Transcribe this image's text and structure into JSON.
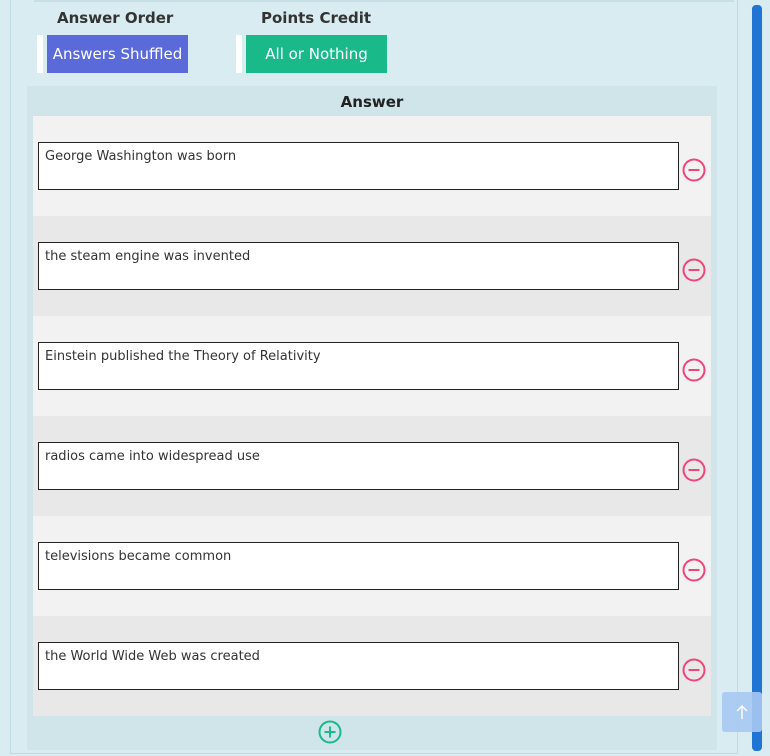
{
  "options": {
    "answer_order": {
      "title": "Answer Order",
      "button_label": "Answers Shuffled",
      "color": "#5a6ad8"
    },
    "points_credit": {
      "title": "Points Credit",
      "button_label": "All or Nothing",
      "color": "#1ab989"
    }
  },
  "answers": {
    "header": "Answer",
    "items": [
      {
        "value": "George Washington was born"
      },
      {
        "value": "the steam engine was invented"
      },
      {
        "value": "Einstein published the Theory of Relativity"
      },
      {
        "value": "radios came into widespread use"
      },
      {
        "value": "televisions became common"
      },
      {
        "value": "the World Wide Web was created"
      }
    ],
    "remove_icon": "minus-circle-icon",
    "add_icon": "plus-circle-icon",
    "remove_color": "#f0457a",
    "add_color": "#1ab989"
  },
  "scroll_top_icon": "arrow-up-icon"
}
